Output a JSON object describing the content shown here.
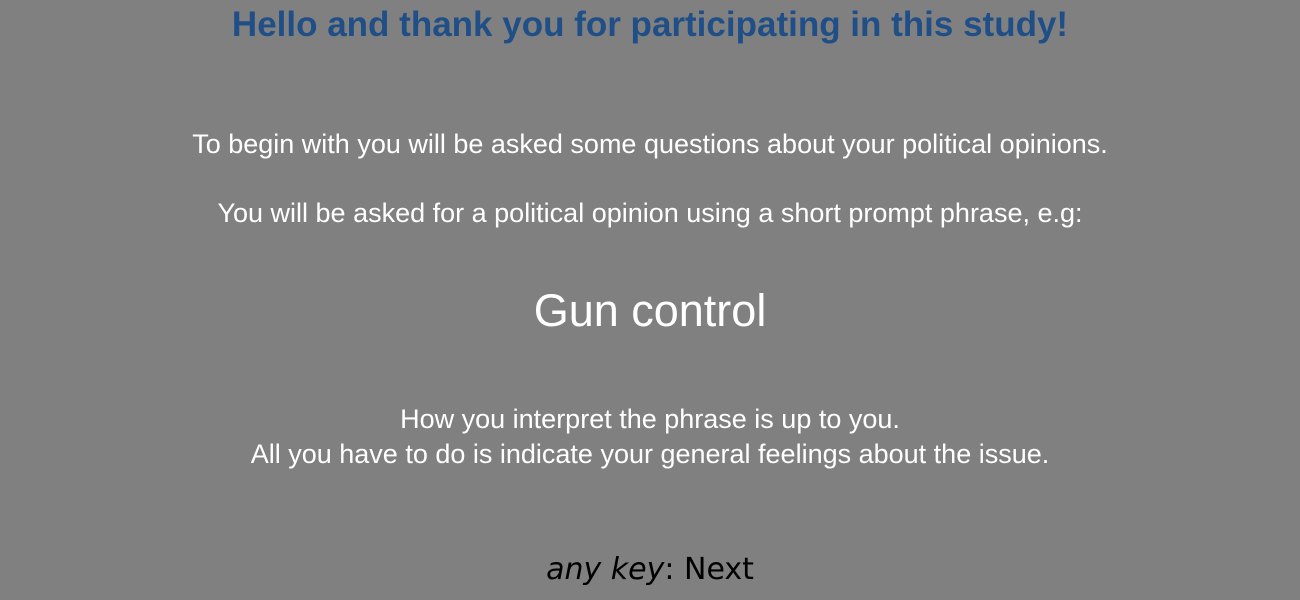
{
  "screen": {
    "title": "Hello and thank you for participating in this study!",
    "intro": "To begin with you will be asked some questions about your political opinions.",
    "prompt_explanation": "You will be asked for a political opinion using a short prompt phrase, e.g:",
    "example_phrase": "Gun control",
    "interpretation_note": "How you interpret the phrase is up to you.",
    "instruction": "All you have to do is indicate your general feelings about the issue."
  },
  "footer": {
    "key_label": "any key",
    "separator": ":",
    "action_label": " Next"
  },
  "colors": {
    "background": "#808080",
    "title": "#1f4f86",
    "body_text": "#ffffff",
    "footer_text": "#000000"
  }
}
